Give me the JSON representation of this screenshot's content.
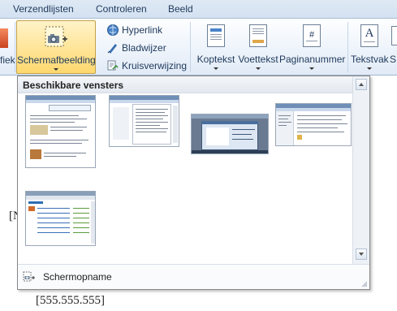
{
  "tabs": [
    "Verzendlijsten",
    "Controleren",
    "Beeld"
  ],
  "ribbon": {
    "left_partial_label": "fiek",
    "screenshot_label": "Schermafbeelding",
    "links": {
      "hyperlink": "Hyperlink",
      "bookmark": "Bladwijzer",
      "cross_reference": "Kruisverwijzing"
    },
    "header_footer": {
      "header": "Koptekst",
      "footer": "Voettekst",
      "page_number": "Paginanummer"
    },
    "text": {
      "textbox": "Tekstvak",
      "partial": "S"
    }
  },
  "gallery": {
    "heading": "Beschikbare vensters",
    "footer_item": "Schermopname",
    "thumbnails": [
      {
        "name": "window-1"
      },
      {
        "name": "window-2"
      },
      {
        "name": "window-3"
      },
      {
        "name": "window-4"
      },
      {
        "name": "window-5"
      }
    ]
  },
  "document": {
    "left_fragment": "[N",
    "phone": "[555.555.555]"
  },
  "colors": {
    "ribbon_bg": "#eef4fb",
    "tab_text": "#1e395b",
    "accent_hover": "#ffd86e",
    "gallery_border": "#868686"
  }
}
